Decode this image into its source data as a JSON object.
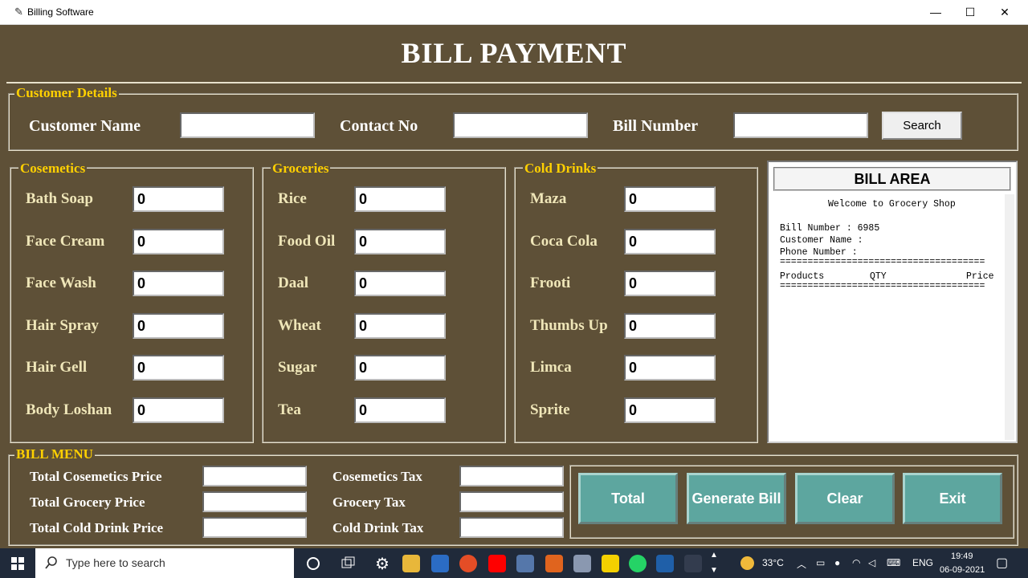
{
  "window": {
    "title": "Billing Software",
    "minimize": "—",
    "maximize": "☐",
    "close": "✕",
    "icon": "✎"
  },
  "header": {
    "title": "BILL PAYMENT"
  },
  "customer": {
    "legend": "Customer Details",
    "name_label": "Customer Name",
    "name_value": "",
    "contact_label": "Contact No",
    "contact_value": "",
    "bill_label": "Bill Number",
    "bill_value": "",
    "search_button": "Search"
  },
  "cosmetics": {
    "legend": "Cosemetics",
    "items": [
      {
        "label": "Bath Soap",
        "value": "0"
      },
      {
        "label": "Face Cream",
        "value": "0"
      },
      {
        "label": "Face Wash",
        "value": "0"
      },
      {
        "label": "Hair Spray",
        "value": "0"
      },
      {
        "label": "Hair Gell",
        "value": "0"
      },
      {
        "label": "Body Loshan",
        "value": "0"
      }
    ]
  },
  "groceries": {
    "legend": "Groceries",
    "items": [
      {
        "label": "Rice",
        "value": "0"
      },
      {
        "label": "Food Oil",
        "value": "0"
      },
      {
        "label": "Daal",
        "value": "0"
      },
      {
        "label": "Wheat",
        "value": "0"
      },
      {
        "label": "Sugar",
        "value": "0"
      },
      {
        "label": "Tea",
        "value": "0"
      }
    ]
  },
  "drinks": {
    "legend": "Cold Drinks",
    "items": [
      {
        "label": "Maza",
        "value": "0"
      },
      {
        "label": "Coca Cola",
        "value": "0"
      },
      {
        "label": "Frooti",
        "value": "0"
      },
      {
        "label": "Thumbs Up",
        "value": "0"
      },
      {
        "label": "Limca",
        "value": "0"
      },
      {
        "label": "Sprite",
        "value": "0"
      }
    ]
  },
  "bill_area": {
    "title": "BILL AREA",
    "welcome": "Welcome to Grocery Shop",
    "bill_number": "Bill Number : 6985",
    "customer_name": "Customer Name :",
    "phone_number": "Phone Number :",
    "separator": "=====================================",
    "col_products": "Products",
    "col_qty": "QTY",
    "col_price": "Price"
  },
  "bill_menu": {
    "legend": "BILL MENU",
    "total_cosmetics_label": "Total Cosemetics Price",
    "total_grocery_label": "Total Grocery Price",
    "total_drink_label": "Total Cold Drink Price",
    "cosmetics_tax_label": "Cosemetics Tax",
    "grocery_tax_label": "Grocery Tax",
    "drink_tax_label": "Cold Drink Tax",
    "total_button": "Total",
    "generate_button": "Generate Bill",
    "clear_button": "Clear",
    "exit_button": "Exit"
  },
  "taskbar": {
    "search_placeholder": "Type here to search",
    "weather": "33°C",
    "language": "ENG",
    "time": "19:49",
    "date": "06-09-2021"
  },
  "colors": {
    "background": "#5e5037",
    "legend": "#ffd000",
    "button": "#5da69f"
  }
}
